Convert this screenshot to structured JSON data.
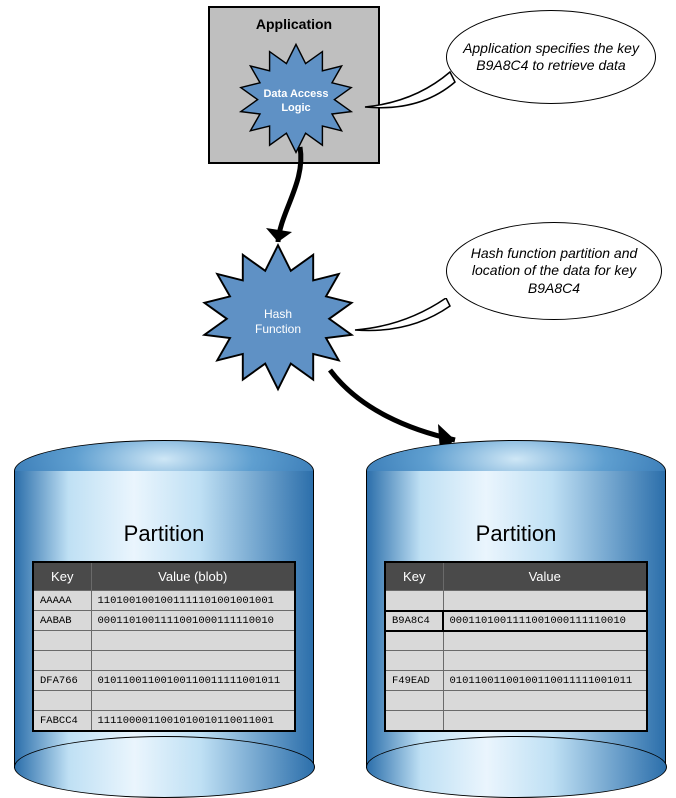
{
  "application": {
    "title": "Application",
    "data_access_logic_label": "Data Access\nLogic"
  },
  "bubbles": {
    "app_bubble": "Application specifies the key B9A8C4 to retrieve data",
    "hash_bubble": "Hash function partition and location of the data for key B9A8C4"
  },
  "hash_function": {
    "label": "Hash\nFunction"
  },
  "partitions": {
    "left": {
      "title": "Partition",
      "columns": {
        "key": "Key",
        "value": "Value (blob)"
      },
      "rows": [
        {
          "key": "AAAAA",
          "value": "1101001001001111101001001001"
        },
        {
          "key": "AABAB",
          "value": "0001101001111001000111110010"
        },
        {
          "key": "",
          "value": ""
        },
        {
          "key": "",
          "value": ""
        },
        {
          "key": "DFA766",
          "value": "01011001100100110011111001011"
        },
        {
          "key": "",
          "value": ""
        },
        {
          "key": "FABCC4",
          "value": "1111000011001010010110011001"
        }
      ]
    },
    "right": {
      "title": "Partition",
      "columns": {
        "key": "Key",
        "value": "Value"
      },
      "rows": [
        {
          "key": "",
          "value": "",
          "highlight": false
        },
        {
          "key": "B9A8C4",
          "value": "0001101001111001000111110010",
          "highlight": true
        },
        {
          "key": "",
          "value": "",
          "highlight": false
        },
        {
          "key": "",
          "value": "",
          "highlight": false
        },
        {
          "key": "F49EAD",
          "value": "01011001100100110011111001011",
          "highlight": false
        },
        {
          "key": "",
          "value": "",
          "highlight": false
        },
        {
          "key": "",
          "value": "",
          "highlight": false
        }
      ]
    }
  }
}
